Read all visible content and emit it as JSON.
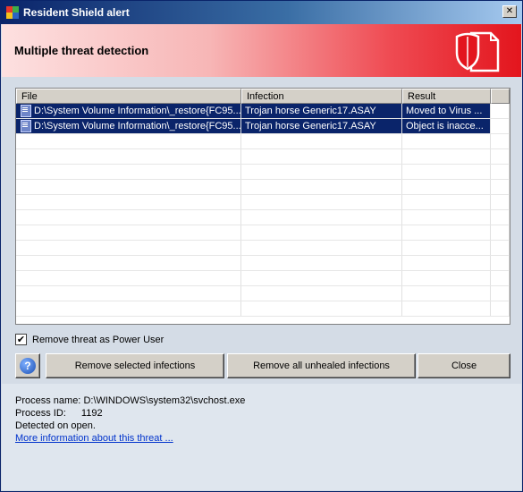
{
  "window": {
    "title": "Resident Shield alert",
    "close_glyph": "✕"
  },
  "banner": {
    "title": "Multiple threat detection",
    "icon": "shield-document-icon"
  },
  "table": {
    "columns": [
      "File",
      "Infection",
      "Result"
    ],
    "rows": [
      {
        "file": "D:\\System Volume Information\\_restore{FC95...",
        "infection": "Trojan horse Generic17.ASAY",
        "result": "Moved to Virus ..."
      },
      {
        "file": "D:\\System Volume Information\\_restore{FC95...",
        "infection": "Trojan horse Generic17.ASAY",
        "result": "Object is inacce..."
      }
    ]
  },
  "options": {
    "power_user_label": "Remove threat as Power User",
    "power_user_checked": true,
    "check_glyph": "✔"
  },
  "buttons": {
    "help_glyph": "?",
    "remove_selected": "Remove selected infections",
    "remove_unhealed": "Remove all unhealed infections",
    "close": "Close"
  },
  "info": {
    "process_name_label": "Process name:",
    "process_name_value": "D:\\WINDOWS\\system32\\svchost.exe",
    "process_id_label": "Process ID:",
    "process_id_value": "1192",
    "detected": "Detected on open.",
    "more_link": "More information about this threat ..."
  },
  "colors": {
    "selection": "#0a246a",
    "banner_red": "#e3151d",
    "link": "#0033cc"
  }
}
